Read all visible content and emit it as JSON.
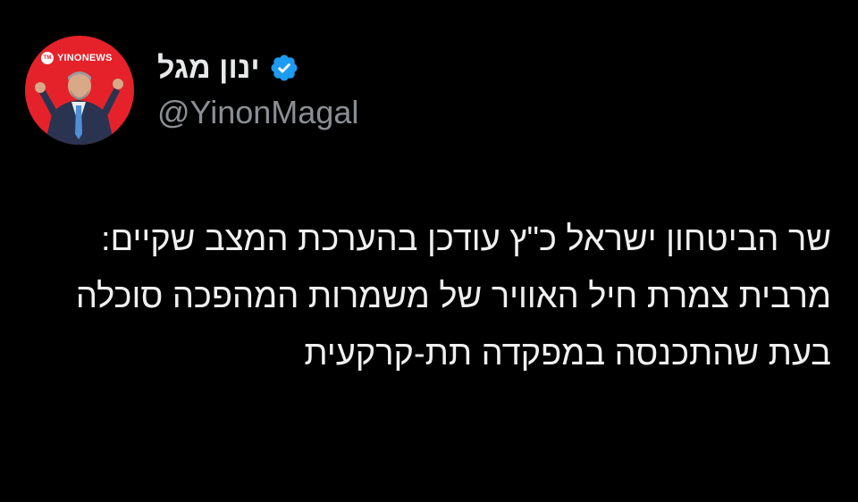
{
  "author": {
    "display_name": "ינון מגל",
    "handle": "@YinonMagal",
    "avatar_logo_text": "YINONEWS",
    "avatar_logo_badge": "TM",
    "verified": true,
    "verified_icon": "verified-badge-icon",
    "verified_color": "#1d9bf0"
  },
  "tweet": {
    "text": "שר הביטחון ישראל כ\"ץ עודכן בהערכת המצב שקיים: מרבית צמרת חיל האוויר של משמרות המהפכה סוכלה בעת שהתכנסה במפקדה תת-קרקעית"
  },
  "colors": {
    "background": "#000000",
    "avatar_background": "#e5222a",
    "text": "#e7e9ea",
    "handle": "#8b8f94"
  }
}
